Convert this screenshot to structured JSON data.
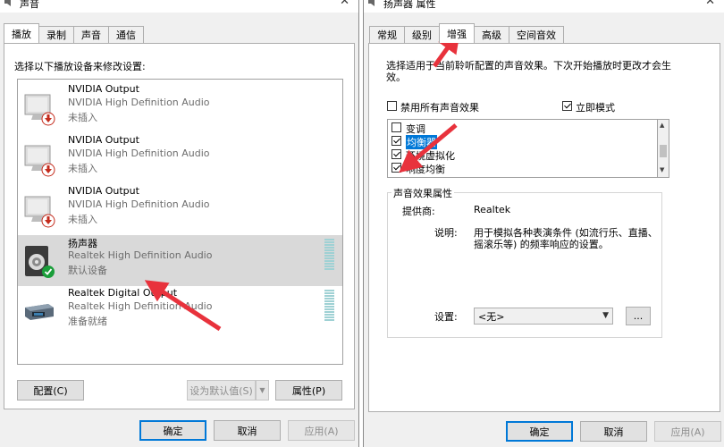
{
  "left_window": {
    "title": "声音",
    "close_label": "✕",
    "tabs": [
      {
        "label": "播放",
        "active": true
      },
      {
        "label": "录制",
        "active": false
      },
      {
        "label": "声音",
        "active": false
      },
      {
        "label": "通信",
        "active": false
      }
    ],
    "instruction": "选择以下播放设备来修改设置:",
    "devices": [
      {
        "name": "NVIDIA Output",
        "driver": "NVIDIA High Definition Audio",
        "status": "未插入",
        "icon": "monitor-icon",
        "badge": "unplugged"
      },
      {
        "name": "NVIDIA Output",
        "driver": "NVIDIA High Definition Audio",
        "status": "未插入",
        "icon": "monitor-icon",
        "badge": "unplugged"
      },
      {
        "name": "NVIDIA Output",
        "driver": "NVIDIA High Definition Audio",
        "status": "未插入",
        "icon": "monitor-icon",
        "badge": "unplugged"
      },
      {
        "name": "扬声器",
        "driver": "Realtek High Definition Audio",
        "status": "默认设备",
        "icon": "speaker-icon",
        "badge": "default"
      },
      {
        "name": "Realtek Digital Output",
        "driver": "Realtek High Definition Audio",
        "status": "准备就绪",
        "icon": "digital-output-icon",
        "badge": "none"
      }
    ],
    "buttons": {
      "configure": "配置(C)",
      "set_default": "设为默认值(S)",
      "properties": "属性(P)",
      "ok": "确定",
      "cancel": "取消",
      "apply": "应用(A)"
    }
  },
  "right_window": {
    "title": "扬声器 属性",
    "close_label": "✕",
    "tabs": [
      {
        "label": "常规",
        "active": false
      },
      {
        "label": "级别",
        "active": false
      },
      {
        "label": "增强",
        "active": true
      },
      {
        "label": "高级",
        "active": false
      },
      {
        "label": "空间音效",
        "active": false
      }
    ],
    "description_line1": "选择适用于当前聆听配置的声音效果。下次开始播放时更改才会生",
    "description_line2": "效。",
    "disable_all": {
      "label": "禁用所有声音效果",
      "checked": false
    },
    "immediate_mode": {
      "label": "立即模式",
      "checked": true
    },
    "effects": [
      {
        "label": "变调",
        "checked": false,
        "highlighted": false
      },
      {
        "label": "均衡器",
        "checked": true,
        "highlighted": true
      },
      {
        "label": "环境虚拟化",
        "checked": true,
        "highlighted": false
      },
      {
        "label": "响度均衡",
        "checked": true,
        "highlighted": false
      }
    ],
    "properties_group": {
      "title": "声音效果属性",
      "provider_label": "提供商:",
      "provider_value": "Realtek",
      "desc_label": "说明:",
      "desc_line1": "用于模拟各种表演条件 (如流行乐、直播、",
      "desc_line2": "摇滚乐等) 的频率响应的设置。",
      "settings_label": "设置:",
      "settings_value": "<无>",
      "more_label": "..."
    },
    "buttons": {
      "ok": "确定",
      "cancel": "取消",
      "apply": "应用(A)"
    }
  },
  "colors": {
    "annotation_arrow": "#e8323c",
    "selection": "#0078d7",
    "default_badge": "#1a9e3a",
    "unplugged_badge": "#c42b1c"
  }
}
